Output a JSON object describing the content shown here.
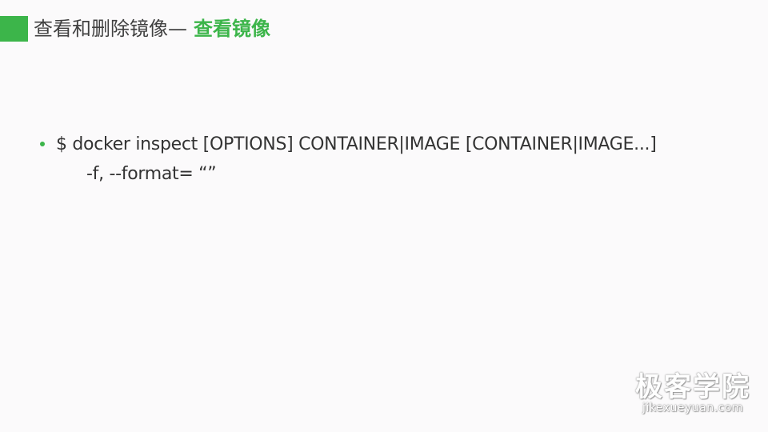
{
  "header": {
    "title_prefix": "查看和删除镜像—",
    "title_highlight": "查看镜像"
  },
  "content": {
    "bullets": [
      {
        "text": "$ docker inspect [OPTIONS] CONTAINER|IMAGE [CONTAINER|IMAGE...]",
        "sub": "-f, --format=  “”"
      }
    ]
  },
  "watermark": {
    "brand": "极客学院",
    "url": "jikexueyuan.com"
  },
  "colors": {
    "accent": "#3cb54a",
    "background": "#fbfafb",
    "text": "#333333"
  }
}
